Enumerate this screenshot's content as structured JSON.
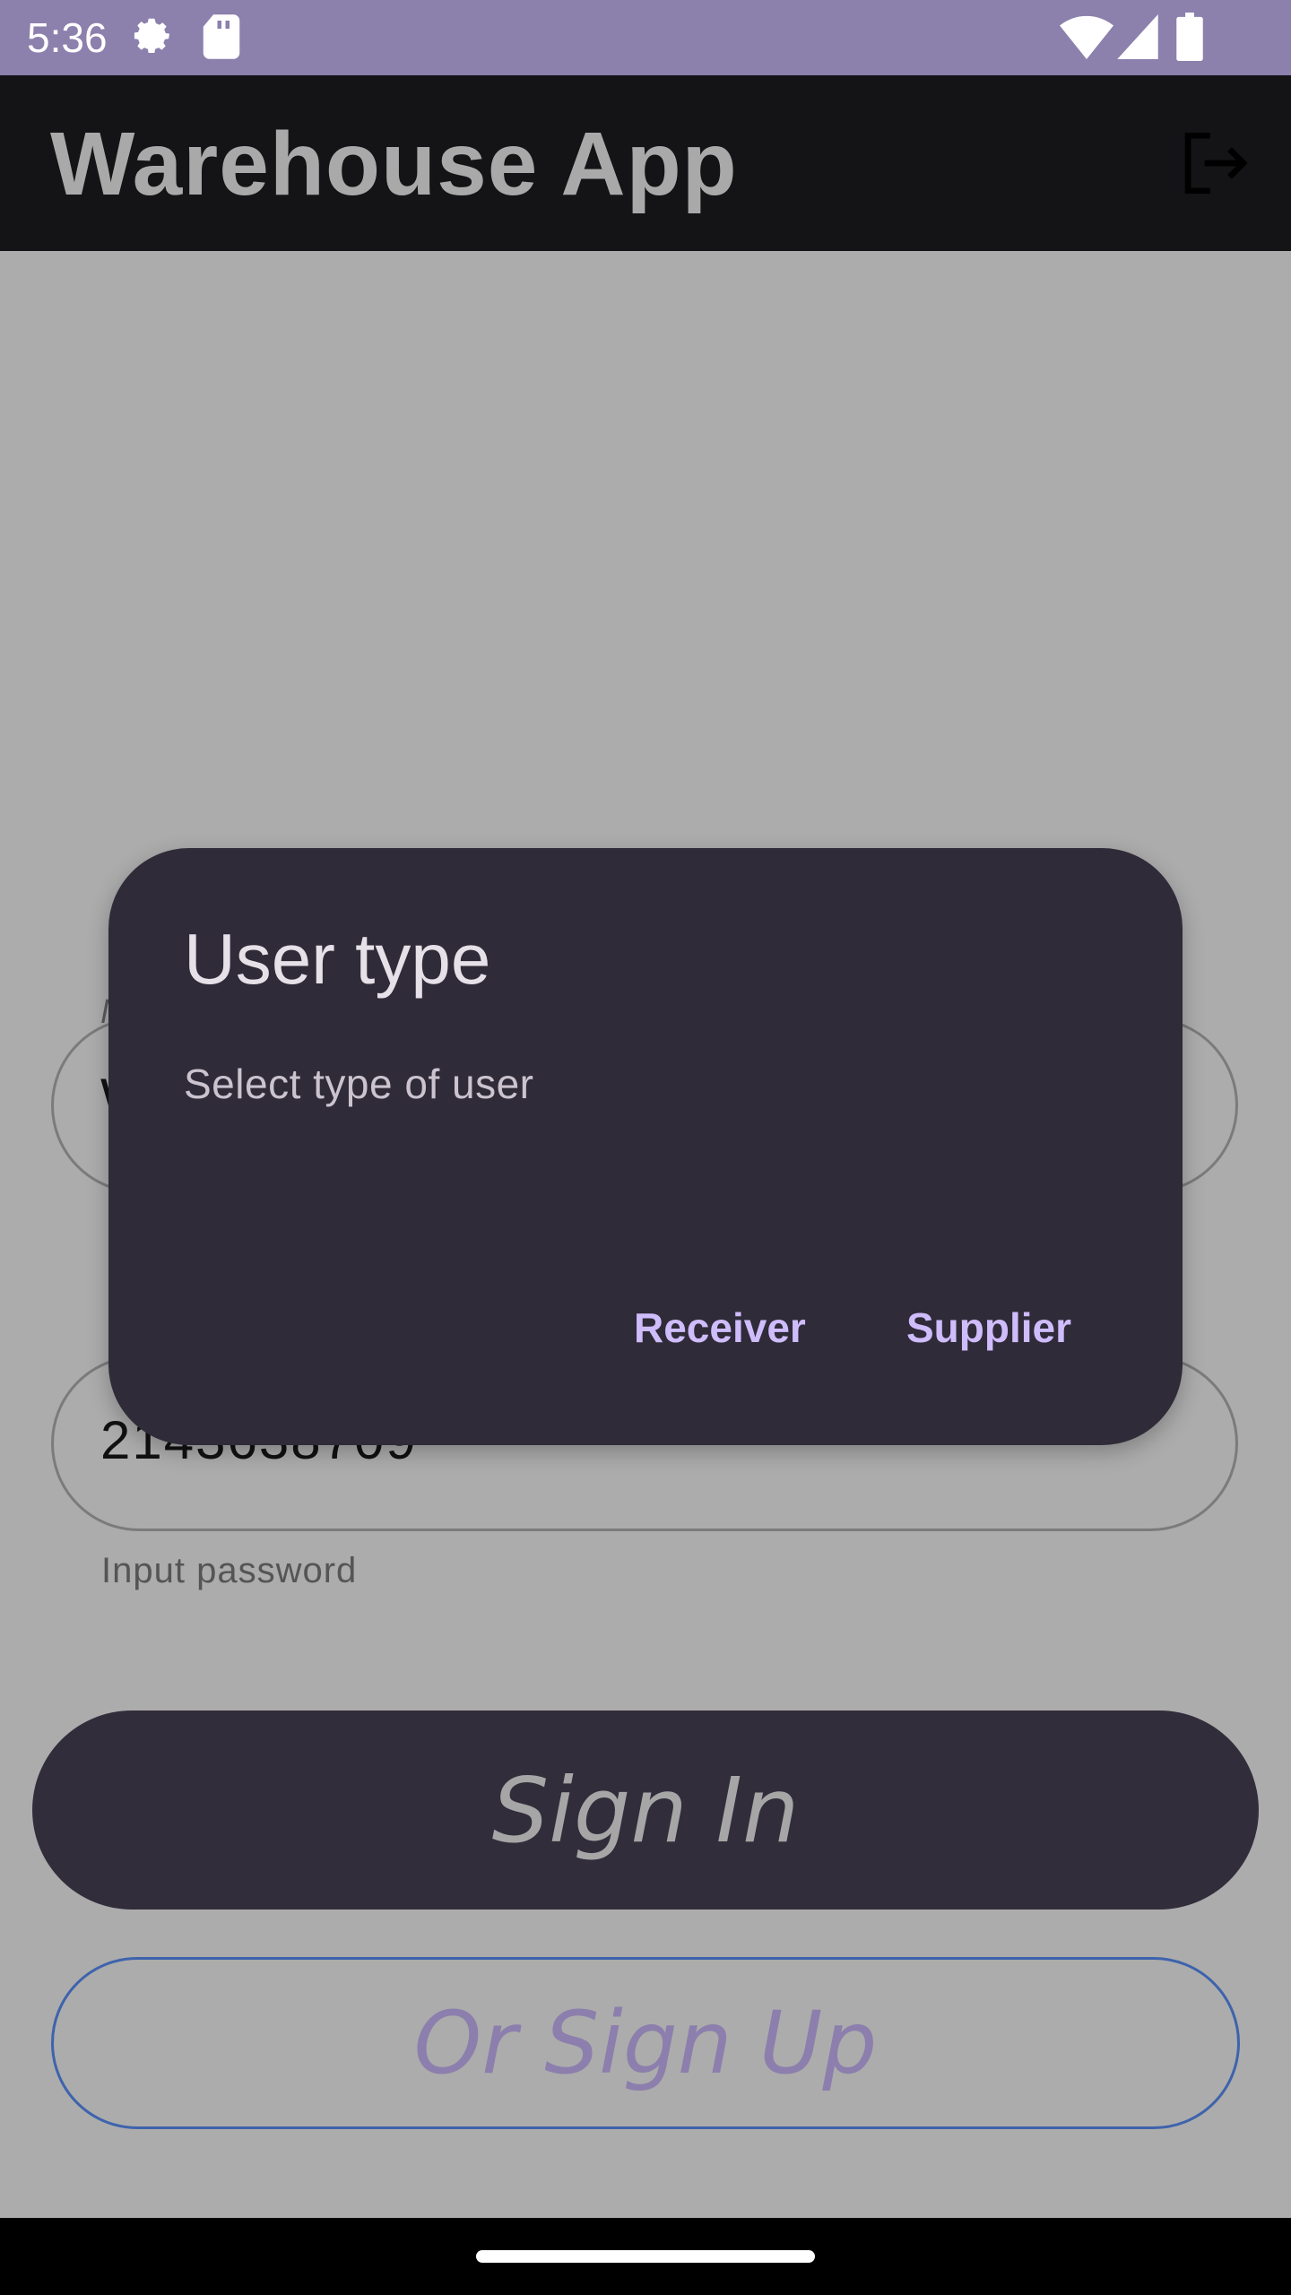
{
  "status_bar": {
    "time": "5:36",
    "icons": [
      "settings-gear-icon",
      "sd-card-icon",
      "wifi-icon",
      "cell-signal-icon",
      "battery-icon"
    ]
  },
  "app_bar": {
    "title": "Warehouse App",
    "action_icon": "logout-icon"
  },
  "form": {
    "login_field": {
      "value": "W"
    },
    "password_field": {
      "value": "2143638709",
      "helper": "Input password"
    },
    "sign_in_label": "Sign In",
    "sign_up_label": "Or Sign Up"
  },
  "dialog": {
    "title": "User type",
    "message": "Select type of user",
    "buttons": {
      "receiver": "Receiver",
      "supplier": "Supplier"
    }
  },
  "colors": {
    "status_bar": "#8c80ad",
    "app_bar": "#141316",
    "scrim_background": "#acacac",
    "dialog_surface": "#2f2b38",
    "dialog_action": "#cfbcfb",
    "sign_up_border": "#3e63ad"
  }
}
